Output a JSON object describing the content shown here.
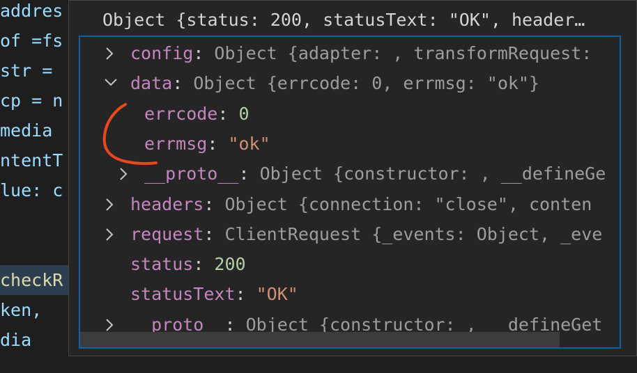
{
  "editor": {
    "lines": [
      {
        "text": "addres",
        "cls": "tok-var"
      },
      {
        "text": "of =fs",
        "cls": "tok-var"
      },
      {
        "text": "str = ",
        "cls": "tok-var"
      },
      {
        "text": "cp = n",
        "cls": "tok-var"
      },
      {
        "text": "media ",
        "cls": "tok-var"
      },
      {
        "text": "ntentT",
        "cls": "tok-var"
      },
      {
        "text": "lue: c",
        "cls": "tok-var"
      },
      {
        "text": "",
        "cls": "tok-var"
      },
      {
        "text": "",
        "cls": "tok-var"
      },
      {
        "text": "checkR",
        "cls": "tok-func"
      },
      {
        "text": "ken,",
        "cls": "tok-var"
      },
      {
        "text": "dia",
        "cls": "tok-var"
      }
    ]
  },
  "hover": {
    "header": "Object {status: 200, statusText: \"OK\", header…",
    "rows": [
      {
        "indent": 0,
        "expanded": false,
        "key": "config",
        "sep": ": ",
        "type": "Object ",
        "summary": "{adapter: , transformRequest: "
      },
      {
        "indent": 0,
        "expanded": true,
        "key": "data",
        "sep": ": ",
        "type": "Object ",
        "summary": "{errcode: 0, errmsg: \"ok\"}"
      },
      {
        "indent": 1,
        "leaf": true,
        "key": "errcode",
        "sep": ": ",
        "value": "0",
        "vtype": "n"
      },
      {
        "indent": 1,
        "leaf": true,
        "key": "errmsg",
        "sep": ": ",
        "value": "\"ok\"",
        "vtype": "s"
      },
      {
        "indent": 1,
        "expanded": false,
        "key": "__proto__",
        "sep": ": ",
        "type": "Object ",
        "summary": "{constructor: , __defineGe"
      },
      {
        "indent": 0,
        "expanded": false,
        "key": "headers",
        "sep": ": ",
        "type": "Object ",
        "summary": "{connection: \"close\", conten"
      },
      {
        "indent": 0,
        "expanded": false,
        "key": "request",
        "sep": ": ",
        "type": "ClientRequest ",
        "summary": "{_events: Object, _eve"
      },
      {
        "indent": 0,
        "leaf": true,
        "key": "status",
        "sep": ": ",
        "value": "200",
        "vtype": "n"
      },
      {
        "indent": 0,
        "leaf": true,
        "key": "statusText",
        "sep": ": ",
        "value": "\"OK\"",
        "vtype": "s"
      },
      {
        "indent": 0,
        "expanded": false,
        "key": "__proto__",
        "sep": ": ",
        "type": "Object ",
        "summary": "{constructor: , __defineGet"
      }
    ]
  },
  "colors": {
    "key": "#c586c0",
    "number": "#b5cea8",
    "string": "#ce9178",
    "annotation": "#e8491d",
    "focus_border": "#0e639c"
  }
}
